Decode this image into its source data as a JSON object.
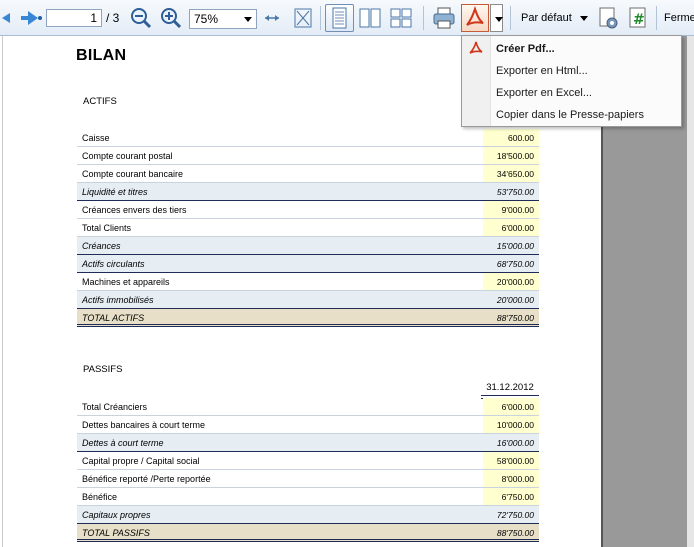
{
  "toolbar": {
    "page_current": "1",
    "page_total": "/ 3",
    "zoom": "75%",
    "format_label": "Par défaut",
    "close_label": "Ferme"
  },
  "menu": {
    "items": [
      "Créer Pdf...",
      "Exporter en Html...",
      "Exporter en Excel...",
      "Copier dans le Presse-papiers"
    ]
  },
  "doc": {
    "title": "BILAN",
    "actifs_header": "ACTIFS",
    "passifs_header": "PASSIFS",
    "date_header": "31.12.2012",
    "actifs": [
      {
        "label": "Caisse",
        "value": "600.00",
        "kind": "item"
      },
      {
        "label": "Compte courant postal",
        "value": "18'500.00",
        "kind": "item"
      },
      {
        "label": "Compte courant bancaire",
        "value": "34'650.00",
        "kind": "item"
      },
      {
        "label": "Liquidité et titres",
        "value": "53'750.00",
        "kind": "sub"
      },
      {
        "label": "Créances envers des tiers",
        "value": "9'000.00",
        "kind": "item"
      },
      {
        "label": "Total Clients",
        "value": "6'000.00",
        "kind": "item"
      },
      {
        "label": "Créances",
        "value": "15'000.00",
        "kind": "sub"
      },
      {
        "label": "Actifs circulants",
        "value": "68'750.00",
        "kind": "sub"
      },
      {
        "label": "Machines et appareils",
        "value": "20'000.00",
        "kind": "item"
      },
      {
        "label": "Actifs immobilisés",
        "value": "20'000.00",
        "kind": "sub"
      },
      {
        "label": "TOTAL ACTIFS",
        "value": "88'750.00",
        "kind": "total"
      }
    ],
    "passifs": [
      {
        "label": "Total Créanciers",
        "value": "6'000.00",
        "kind": "item"
      },
      {
        "label": "Dettes bancaires à court terme",
        "value": "10'000.00",
        "kind": "item"
      },
      {
        "label": "Dettes à court terme",
        "value": "16'000.00",
        "kind": "sub"
      },
      {
        "label": "Capital propre / Capital social",
        "value": "58'000.00",
        "kind": "item"
      },
      {
        "label": "Bénéfice reporté /Perte reportée",
        "value": "8'000.00",
        "kind": "item"
      },
      {
        "label": "Bénéfice",
        "value": "6'750.00",
        "kind": "item"
      },
      {
        "label": "Capitaux propres",
        "value": "72'750.00",
        "kind": "sub"
      },
      {
        "label": "TOTAL PASSIFS",
        "value": "88'750.00",
        "kind": "total"
      }
    ]
  }
}
